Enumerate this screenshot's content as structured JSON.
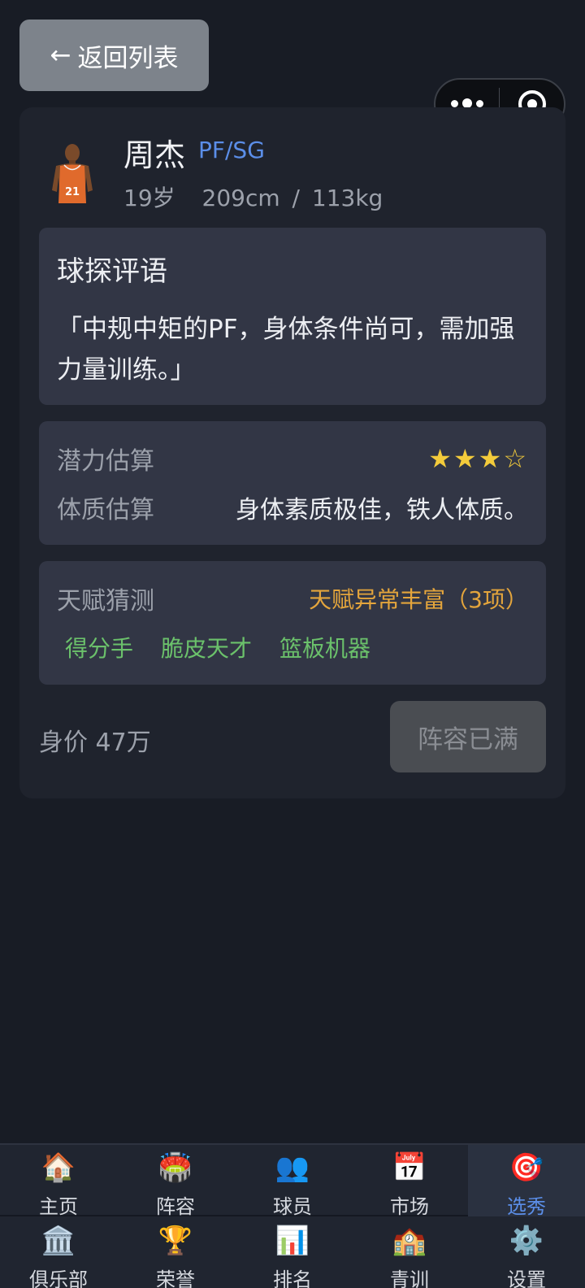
{
  "back_button": {
    "arrow": "←",
    "label": "返回列表"
  },
  "player": {
    "name": "周杰",
    "position": "PF/SG",
    "age": "19岁",
    "body": "209cm / 113kg",
    "jersey_number": "21"
  },
  "scout_comment": {
    "title": "球探评语",
    "text": "「中规中矩的PF，身体条件尚可，需加强力量训练。」"
  },
  "estimates": {
    "potential_label": "潜力估算",
    "potential_stars_text": "★★★☆",
    "potential_rating": 3,
    "potential_max": 4,
    "physique_label": "体质估算",
    "physique_value": "身体素质极佳，铁人体质。"
  },
  "talent": {
    "label": "天赋猜测",
    "summary": "天赋异常丰富（3项）",
    "tags": [
      "得分手",
      "脆皮天才",
      "篮板机器"
    ]
  },
  "price_text": "身价 47万",
  "full_button_label": "阵容已满",
  "tabs_row1": [
    {
      "icon": "🏠",
      "label": "主页",
      "active": false
    },
    {
      "icon": "🏟️",
      "label": "阵容",
      "active": false
    },
    {
      "icon": "👥",
      "label": "球员",
      "active": false
    },
    {
      "icon": "📅",
      "label": "市场",
      "active": false
    },
    {
      "icon": "🎯",
      "label": "选秀",
      "active": true
    }
  ],
  "tabs_row2": [
    {
      "icon": "🏛️",
      "label": "俱乐部",
      "active": false
    },
    {
      "icon": "🏆",
      "label": "荣誉",
      "active": false
    },
    {
      "icon": "📊",
      "label": "排名",
      "active": false
    },
    {
      "icon": "🏫",
      "label": "青训",
      "active": false
    },
    {
      "icon": "⚙️",
      "label": "设置",
      "active": false
    }
  ],
  "colors": {
    "accent_blue": "#5b8ee8",
    "star_yellow": "#f3cb3b",
    "talent_orange": "#e4a53c",
    "tag_green": "#6bc16b",
    "jersey_orange": "#e06a2c"
  }
}
